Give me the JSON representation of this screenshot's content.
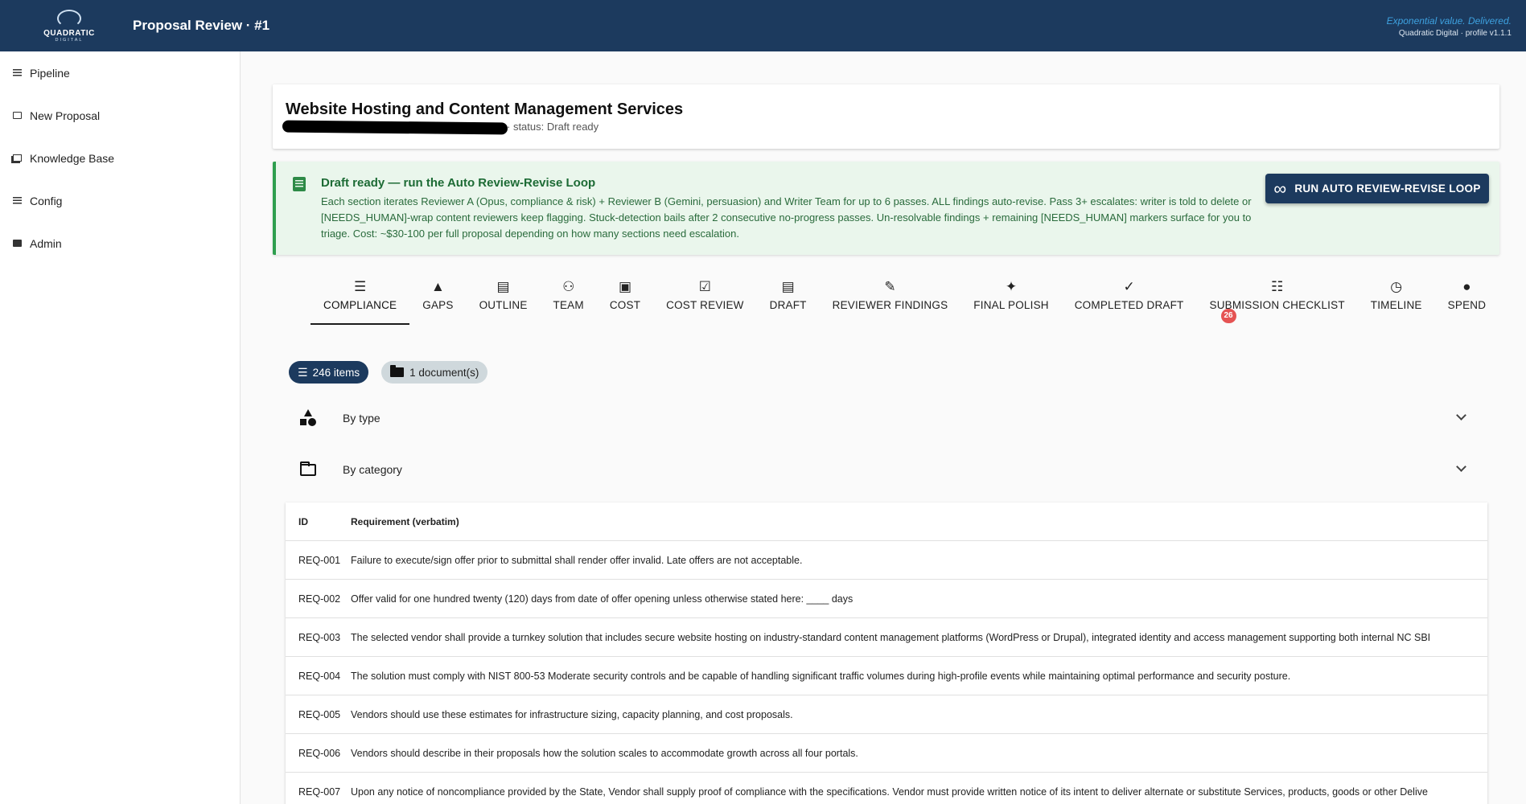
{
  "topbar": {
    "logo_word": "QUADRATIC",
    "logo_sub": "DIGITAL",
    "title": "Proposal Review · #1",
    "tagline": "Exponential value. Delivered.",
    "profile": "Quadratic Digital · profile v1.1.1"
  },
  "sidebar": {
    "items": [
      {
        "label": "Pipeline",
        "icon": "list-icon"
      },
      {
        "label": "New Proposal",
        "icon": "edit-icon"
      },
      {
        "label": "Knowledge Base",
        "icon": "library-icon"
      },
      {
        "label": "Config",
        "icon": "tune-icon"
      },
      {
        "label": "Admin",
        "icon": "admin-icon"
      }
    ]
  },
  "proposal": {
    "title": "Website Hosting and Content Management Services",
    "status": "· status: Draft ready"
  },
  "banner": {
    "title": "Draft ready — run the Auto Review-Revise Loop",
    "body": "Each section iterates Reviewer A (Opus, compliance & risk) + Reviewer B (Gemini, persuasion) and Writer Team for up to 6 passes. ALL findings auto-revise. Pass 3+ escalates: writer is told to delete or [NEEDS_HUMAN]-wrap content reviewers keep flagging. Stuck-detection bails after 2 consecutive no-progress passes. Un-resolvable findings + remaining [NEEDS_HUMAN] markers surface for you to triage. Cost: ~$30-100 per full proposal depending on how many sections need escalation.",
    "button": "RUN AUTO REVIEW-REVISE LOOP",
    "accent_color": "#2e9e4e"
  },
  "tabs": [
    {
      "label": "COMPLIANCE",
      "icon": "☰",
      "active": true
    },
    {
      "label": "GAPS",
      "icon": "▲"
    },
    {
      "label": "OUTLINE",
      "icon": "▤"
    },
    {
      "label": "TEAM",
      "icon": "⚇"
    },
    {
      "label": "COST",
      "icon": "▣"
    },
    {
      "label": "COST REVIEW",
      "icon": "☑"
    },
    {
      "label": "DRAFT",
      "icon": "▤"
    },
    {
      "label": "REVIEWER FINDINGS",
      "icon": "✎"
    },
    {
      "label": "FINAL POLISH",
      "icon": "✦"
    },
    {
      "label": "COMPLETED DRAFT",
      "icon": "✓"
    },
    {
      "label": "SUBMISSION CHECKLIST",
      "icon": "☷",
      "badge": "26"
    },
    {
      "label": "TIMELINE",
      "icon": "◷"
    },
    {
      "label": "SPEND",
      "icon": "●"
    }
  ],
  "chips": {
    "items": "246 items",
    "documents": "1 document(s)"
  },
  "accordions": {
    "by_type": "By type",
    "by_category": "By category"
  },
  "table": {
    "headers": {
      "id": "ID",
      "requirement": "Requirement (verbatim)"
    },
    "rows": [
      {
        "id": "REQ-001",
        "text": "Failure to execute/sign offer prior to submittal shall render offer invalid. Late offers are not acceptable."
      },
      {
        "id": "REQ-002",
        "text": "Offer valid for one hundred twenty (120) days from date of offer opening unless otherwise stated here: ____ days"
      },
      {
        "id": "REQ-003",
        "text": "The selected vendor shall provide a turnkey solution that includes secure website hosting on industry-standard content management platforms (WordPress or Drupal), integrated identity and access management supporting both internal NC SBI"
      },
      {
        "id": "REQ-004",
        "text": "The solution must comply with NIST 800-53 Moderate security controls and be capable of handling significant traffic volumes during high-profile events while maintaining optimal performance and security posture."
      },
      {
        "id": "REQ-005",
        "text": "Vendors should use these estimates for infrastructure sizing, capacity planning, and cost proposals."
      },
      {
        "id": "REQ-006",
        "text": "Vendors should describe in their proposals how the solution scales to accommodate growth across all four portals."
      },
      {
        "id": "REQ-007",
        "text": "Upon any notice of noncompliance provided by the State, Vendor shall supply proof of compliance with the specifications. Vendor must provide written notice of its intent to deliver alternate or substitute Services, products, goods or other Delive"
      }
    ]
  }
}
